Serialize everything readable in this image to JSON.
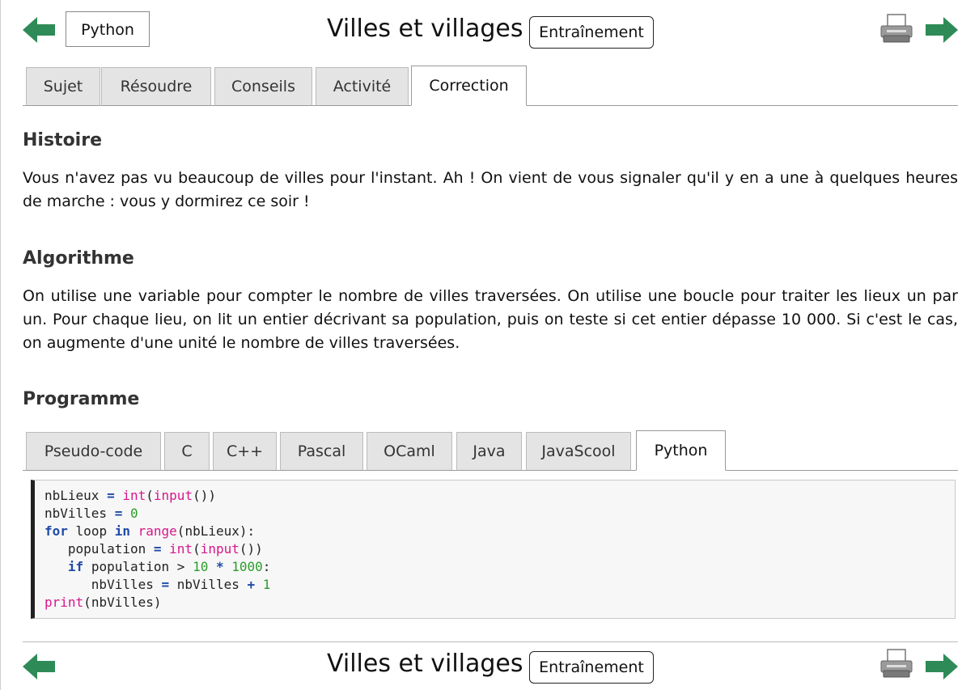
{
  "header": {
    "language_button": "Python",
    "title": "Villes et villages",
    "mode_button": "Entraînement",
    "prev_icon": "arrow-left-icon",
    "next_icon": "arrow-right-icon",
    "print_icon": "printer-icon"
  },
  "tabs": [
    {
      "label": "Sujet",
      "active": false
    },
    {
      "label": "Résoudre",
      "active": false
    },
    {
      "label": "Conseils",
      "active": false
    },
    {
      "label": "Activité",
      "active": false
    },
    {
      "label": "Correction",
      "active": true
    }
  ],
  "sections": {
    "histoire": {
      "heading": "Histoire",
      "text": "Vous n'avez pas vu beaucoup de villes pour l'instant. Ah ! On vient de vous signaler qu'il y en a une à quelques heures de marche : vous y dormirez ce soir !"
    },
    "algorithme": {
      "heading": "Algorithme",
      "text": "On utilise une variable pour compter le nombre de villes traversées. On utilise une boucle pour traiter les lieux un par un. Pour chaque lieu, on lit un entier décrivant sa population, puis on teste si cet entier dépasse 10 000. Si c'est le cas, on augmente d'une unité le nombre de villes traversées."
    },
    "programme": {
      "heading": "Programme"
    }
  },
  "code_tabs": [
    {
      "label": "Pseudo-code",
      "active": false
    },
    {
      "label": "C",
      "active": false
    },
    {
      "label": "C++",
      "active": false
    },
    {
      "label": "Pascal",
      "active": false
    },
    {
      "label": "OCaml",
      "active": false
    },
    {
      "label": "Java",
      "active": false
    },
    {
      "label": "JavaScool",
      "active": false
    },
    {
      "label": "Python",
      "active": true
    }
  ],
  "code": {
    "l1_var": "nbLieux",
    "l1_op": "=",
    "l1_int": "int",
    "l1_input": "input",
    "l2_var": "nbVilles",
    "l2_op": "=",
    "l2_val": "0",
    "l3_for": "for",
    "l3_var": "loop",
    "l3_in": "in",
    "l3_range": "range",
    "l3_arg": "nbLieux",
    "l4_var": "population",
    "l4_op": "=",
    "l4_int": "int",
    "l4_input": "input",
    "l5_if": "if",
    "l5_var": "population",
    "l5_cmp": ">",
    "l5_n1": "10",
    "l5_mul": "*",
    "l5_n2": "1000",
    "l6_var": "nbVilles",
    "l6_op": "=",
    "l6_var2": "nbVilles",
    "l6_plus": "+",
    "l6_n": "1",
    "l7_print": "print",
    "l7_arg": "nbVilles"
  },
  "footer": {
    "title": "Villes et villages",
    "mode_button": "Entraînement"
  },
  "colors": {
    "arrow_green": "#2e8b57",
    "keyword_blue": "#1f4aa8",
    "builtin_pink": "#d6168a",
    "number_green": "#2a9d2a"
  }
}
